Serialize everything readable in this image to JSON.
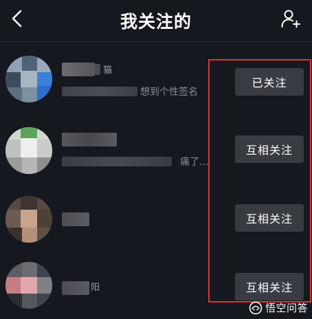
{
  "header": {
    "title": "我关注的",
    "back_icon": "chevron-left-icon",
    "add_icon": "add-user-icon"
  },
  "list": [
    {
      "name_suffix": "猫",
      "signature_visible": "想到个性签名",
      "button_label": "已关注"
    },
    {
      "name_suffix": "",
      "signature_visible": "痛了...",
      "button_label": "互相关注"
    },
    {
      "name_suffix": "",
      "signature_visible": "",
      "button_label": "互相关注"
    },
    {
      "name_suffix": "阳",
      "signature_visible": "",
      "button_label": "互相关注"
    }
  ],
  "annotation": {
    "color": "#e0303c"
  },
  "watermark": {
    "text": "悟空问答",
    "logo_icon": "wukong-logo-icon"
  },
  "colors": {
    "background": "#16181f",
    "button_bg": "#393b42",
    "secondary_text": "#8a8c93"
  }
}
